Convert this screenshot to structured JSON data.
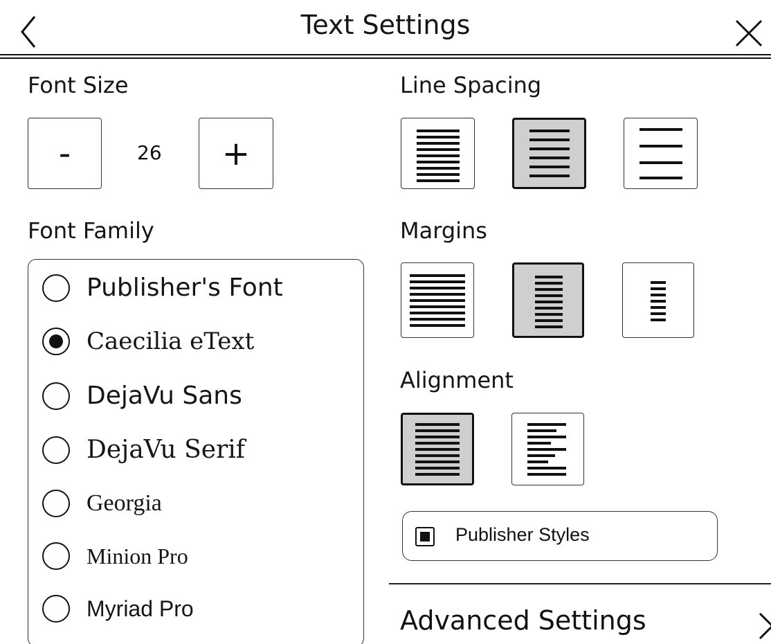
{
  "header": {
    "title": "Text Settings",
    "back_icon": "chevron-left-icon",
    "close_icon": "close-icon"
  },
  "font_size": {
    "label": "Font Size",
    "decrease_label": "-",
    "increase_label": "+",
    "value": "26"
  },
  "line_spacing": {
    "label": "Line Spacing",
    "options": [
      "compact",
      "normal",
      "wide"
    ],
    "selected": "normal"
  },
  "font_family": {
    "label": "Font Family",
    "items": [
      {
        "label": "Publisher's Font",
        "selected": false
      },
      {
        "label": "Caecilia eText",
        "selected": true
      },
      {
        "label": "DejaVu Sans",
        "selected": false
      },
      {
        "label": "DejaVu Serif",
        "selected": false
      },
      {
        "label": "Georgia",
        "selected": false
      },
      {
        "label": "Minion Pro",
        "selected": false
      },
      {
        "label": "Myriad Pro",
        "selected": false
      }
    ]
  },
  "margins": {
    "label": "Margins",
    "options": [
      "narrow",
      "medium",
      "wide"
    ],
    "selected": "medium"
  },
  "alignment": {
    "label": "Alignment",
    "options": [
      "justify",
      "left"
    ],
    "selected": "justify"
  },
  "publisher_styles": {
    "label": "Publisher Styles",
    "checked": true
  },
  "advanced": {
    "label": "Advanced Settings",
    "icon": "chevron-right-icon"
  }
}
